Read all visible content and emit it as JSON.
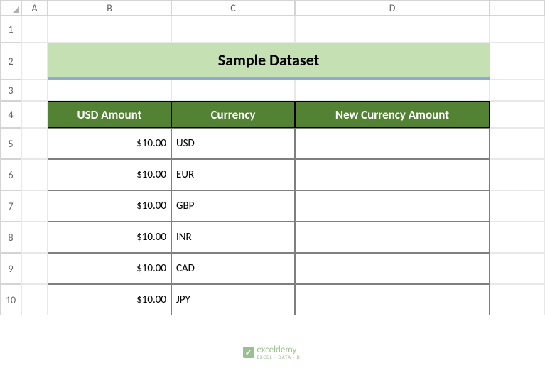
{
  "columns": [
    "A",
    "B",
    "C",
    "D"
  ],
  "rows": [
    "1",
    "2",
    "3",
    "4",
    "5",
    "6",
    "7",
    "8",
    "9",
    "10"
  ],
  "title": "Sample Dataset",
  "headers": {
    "b": "USD Amount",
    "c": "Currency",
    "d": "New Currency Amount"
  },
  "data": [
    {
      "amount": "$10.00",
      "currency": "USD",
      "new": ""
    },
    {
      "amount": "$10.00",
      "currency": "EUR",
      "new": ""
    },
    {
      "amount": "$10.00",
      "currency": "GBP",
      "new": ""
    },
    {
      "amount": "$10.00",
      "currency": "INR",
      "new": ""
    },
    {
      "amount": "$10.00",
      "currency": "CAD",
      "new": ""
    },
    {
      "amount": "$10.00",
      "currency": "JPY",
      "new": ""
    }
  ],
  "watermark": {
    "name": "exceldemy",
    "sub": "EXCEL · DATA · BI"
  }
}
